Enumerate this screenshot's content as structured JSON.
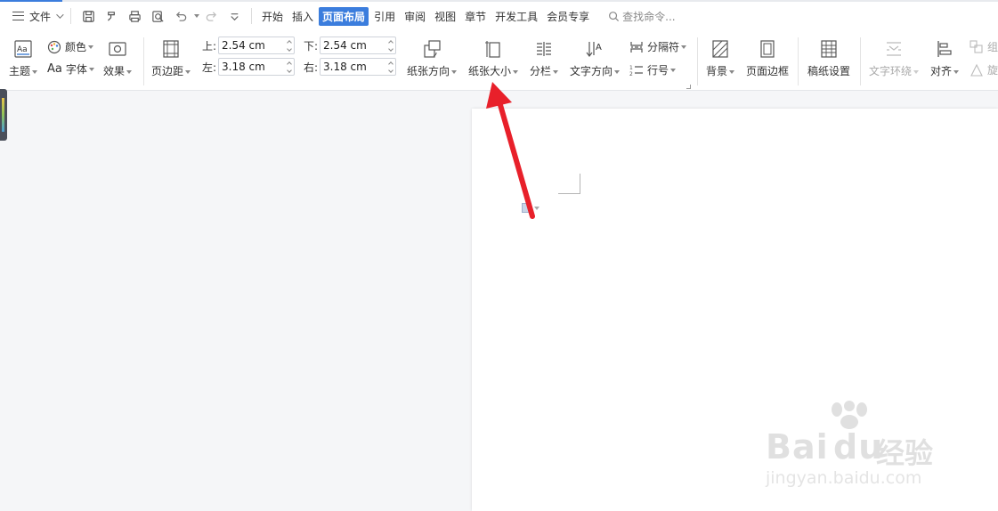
{
  "tabbar": {
    "menu_label": "文件",
    "tabs": [
      "开始",
      "插入",
      "页面布局",
      "引用",
      "审阅",
      "视图",
      "章节",
      "开发工具",
      "会员专享"
    ],
    "active_tab": "页面布局",
    "search_placeholder": "查找命令..."
  },
  "ribbon": {
    "theme": "主题",
    "color": "颜色",
    "font": "字体",
    "effect": "效果",
    "margins": "页边距",
    "margin_top_label": "上:",
    "margin_top": "2.54 cm",
    "margin_bottom_label": "下:",
    "margin_bottom": "2.54 cm",
    "margin_left_label": "左:",
    "margin_left": "3.18 cm",
    "margin_right_label": "右:",
    "margin_right": "3.18 cm",
    "orientation": "纸张方向",
    "paper_size": "纸张大小",
    "columns": "分栏",
    "text_direction": "文字方向",
    "break": "分隔符",
    "line_numbers": "行号",
    "background": "背景",
    "page_border": "页面边框",
    "manuscript": "稿纸设置",
    "text_wrap": "文字环绕",
    "align": "对齐",
    "group": "组",
    "rotate": "旋"
  },
  "watermark": {
    "brand": "Bai",
    "brand_suffix": "du",
    "cn": "经验",
    "url": "jingyan.baidu.com"
  },
  "colors": {
    "accent": "#3b7ddd",
    "arrow": "#e8202a"
  }
}
